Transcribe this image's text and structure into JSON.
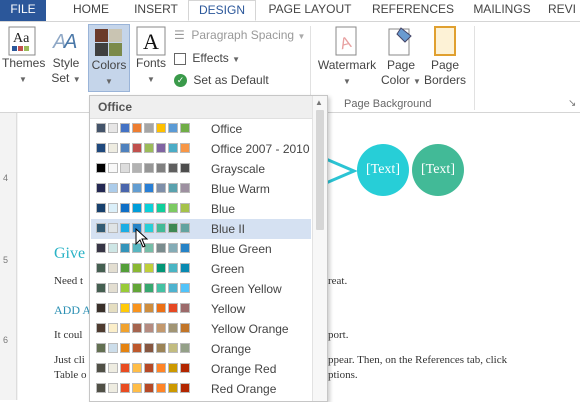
{
  "tabs": [
    {
      "label": "FILE"
    },
    {
      "label": "HOME"
    },
    {
      "label": "INSERT"
    },
    {
      "label": "DESIGN"
    },
    {
      "label": "PAGE LAYOUT"
    },
    {
      "label": "REFERENCES"
    },
    {
      "label": "MAILINGS"
    },
    {
      "label": "REVI"
    }
  ],
  "ribbon": {
    "themes": {
      "label": "Themes"
    },
    "style_set": {
      "line1": "Style",
      "line2": "Set"
    },
    "colors": {
      "label": "Colors"
    },
    "fonts": {
      "label": "Fonts"
    },
    "paragraph_spacing": {
      "label": "Paragraph Spacing"
    },
    "effects": {
      "label": "Effects"
    },
    "set_as_default": {
      "label": "Set as Default"
    },
    "watermark": {
      "label": "Watermark"
    },
    "page_color": {
      "line1": "Page",
      "line2": "Color"
    },
    "page_borders": {
      "line1": "Page",
      "line2": "Borders"
    },
    "group_page_background": "Page Background"
  },
  "ruler": {
    "n4": "4",
    "n5": "5",
    "n6": "6"
  },
  "document": {
    "smartart_text_1": "[Text]",
    "smartart_text_2": "[Text]",
    "heading": "Give",
    "line1_left": "Need t",
    "line1_right": "reat.",
    "subhead": "ADD A",
    "line2_left": "It coul",
    "line2_right": "port.",
    "line3_left": "Just cli",
    "line3_right": "ppear. Then, on the References tab, click",
    "line4_left": "Table o",
    "line4_right": "ptions."
  },
  "dropdown": {
    "header": "Office",
    "themes": [
      {
        "name": "Office",
        "colors": [
          "#44546a",
          "#e7e6e6",
          "#4472c4",
          "#ed7d31",
          "#a5a5a5",
          "#ffc000",
          "#5b9bd5",
          "#70ad47"
        ]
      },
      {
        "name": "Office 2007 - 2010",
        "colors": [
          "#1f497d",
          "#eeece1",
          "#4f81bd",
          "#c0504d",
          "#9bbb59",
          "#8064a2",
          "#4bacc6",
          "#f79646"
        ]
      },
      {
        "name": "Grayscale",
        "colors": [
          "#000000",
          "#f8f8f8",
          "#dddddd",
          "#b2b2b2",
          "#969696",
          "#808080",
          "#5f5f5f",
          "#4d4d4d"
        ]
      },
      {
        "name": "Blue Warm",
        "colors": [
          "#242852",
          "#acccea",
          "#4a66ac",
          "#629dd1",
          "#297fd5",
          "#7f8fa9",
          "#5aa2ae",
          "#9d90a0"
        ]
      },
      {
        "name": "Blue",
        "colors": [
          "#17406d",
          "#dbeff9",
          "#0f6fc6",
          "#009dd9",
          "#0bd0d9",
          "#10cf9b",
          "#7cca62",
          "#a5c249"
        ]
      },
      {
        "name": "Blue II",
        "colors": [
          "#335b74",
          "#dfe3e5",
          "#1cade4",
          "#2683c6",
          "#27ced7",
          "#42ba97",
          "#3e8853",
          "#62a39f"
        ]
      },
      {
        "name": "Blue Green",
        "colors": [
          "#373545",
          "#cee6e5",
          "#3494ba",
          "#58b6c0",
          "#75bda7",
          "#7a8c8e",
          "#84acb6",
          "#2683c6"
        ]
      },
      {
        "name": "Green",
        "colors": [
          "#455f51",
          "#e3ded1",
          "#549e39",
          "#8ab833",
          "#c0cf3a",
          "#029676",
          "#4ab5c4",
          "#0989b1"
        ]
      },
      {
        "name": "Green Yellow",
        "colors": [
          "#455f51",
          "#e3ded1",
          "#99cb38",
          "#63a537",
          "#37a76f",
          "#44c1a3",
          "#4eb3cf",
          "#51c3f9"
        ]
      },
      {
        "name": "Yellow",
        "colors": [
          "#39302a",
          "#e5dec1",
          "#ffca08",
          "#f8931d",
          "#ce8d3e",
          "#ec7016",
          "#e64823",
          "#9c6a6a"
        ]
      },
      {
        "name": "Yellow Orange",
        "colors": [
          "#4e3b30",
          "#fbeec9",
          "#f0a22e",
          "#a5644e",
          "#b58b80",
          "#c3986d",
          "#a19574",
          "#c17529"
        ]
      },
      {
        "name": "Orange",
        "colors": [
          "#637052",
          "#ccddea",
          "#e48312",
          "#bd582c",
          "#865640",
          "#9b8357",
          "#c2bc80",
          "#94a088"
        ]
      },
      {
        "name": "Orange Red",
        "colors": [
          "#505046",
          "#eeece1",
          "#e84c22",
          "#ffbd47",
          "#b64926",
          "#ff8427",
          "#cc9900",
          "#b22600"
        ]
      },
      {
        "name": "Red Orange",
        "colors": [
          "#505046",
          "#eeece1",
          "#e84c22",
          "#ffbd47",
          "#b64926",
          "#ff8427",
          "#cc9900",
          "#b22600"
        ]
      }
    ]
  }
}
